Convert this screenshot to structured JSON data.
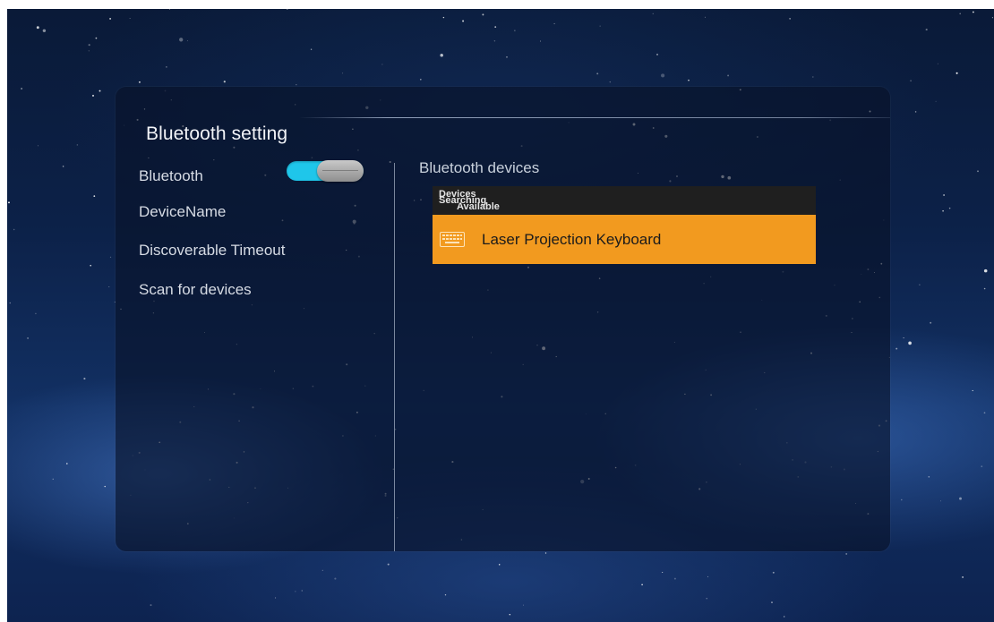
{
  "title": "Bluetooth setting",
  "menu": {
    "items": [
      {
        "label": "Bluetooth"
      },
      {
        "label": "DeviceName"
      },
      {
        "label": "Discoverable Timeout"
      },
      {
        "label": "Scan for devices"
      }
    ],
    "bluetooth_toggle": {
      "state": "on",
      "color": "#1fc6ea"
    }
  },
  "devices_panel": {
    "heading": "Bluetooth devices",
    "header": {
      "line1": "Devices",
      "line2": "Searching",
      "line3": "Available"
    },
    "devices": [
      {
        "name": "Laser Projection Keyboard",
        "icon": "keyboard-icon",
        "selected": true
      }
    ],
    "highlight_color": "#f29a1f"
  }
}
